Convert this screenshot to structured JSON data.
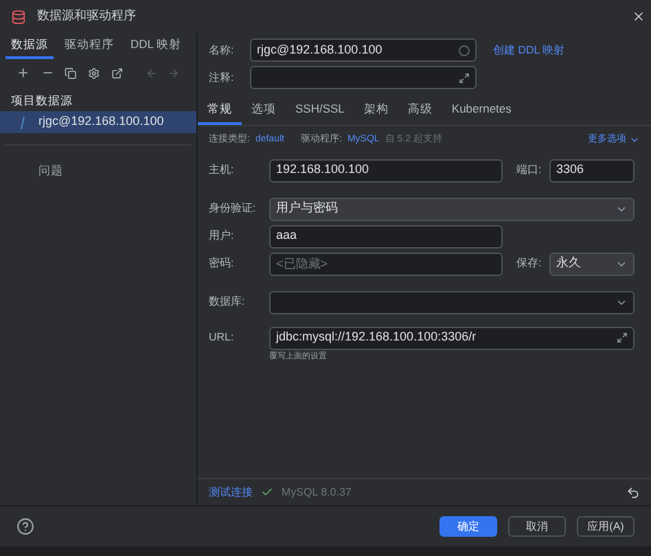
{
  "window": {
    "title": "数据源和驱动程序"
  },
  "left_tabs": [
    {
      "label": "数据源",
      "selected": true
    },
    {
      "label": "驱动程序",
      "selected": false
    },
    {
      "label": "DDL 映射",
      "selected": false
    }
  ],
  "sidebar": {
    "section": "项目数据源",
    "items": [
      {
        "label": "rjgc@192.168.100.100",
        "selected": true
      }
    ],
    "problems": "问题"
  },
  "header": {
    "name_label": "名称:",
    "name_value": "rjgc@192.168.100.100",
    "ddl_link": "创建 DDL 映射",
    "comment_label": "注释:"
  },
  "tabs": [
    {
      "label": "常规",
      "selected": true
    },
    {
      "label": "选项",
      "selected": false
    },
    {
      "label": "SSH/SSL",
      "selected": false
    },
    {
      "label": "架构",
      "selected": false
    },
    {
      "label": "高级",
      "selected": false
    },
    {
      "label": "Kubernetes",
      "selected": false
    }
  ],
  "info": {
    "conn_type_label": "连接类型:",
    "conn_type": "default",
    "driver_label": "驱动程序:",
    "driver": "MySQL",
    "driver_note": "自 5.2 起支持",
    "more": "更多选项"
  },
  "host": {
    "label": "主机:",
    "value": "192.168.100.100",
    "port_label": "端口:",
    "port": "3306"
  },
  "auth": {
    "label": "身份验证:",
    "value": "用户与密码"
  },
  "user": {
    "label": "用户:",
    "value": "aaa"
  },
  "password": {
    "label": "密码:",
    "placeholder": "<已隐藏>",
    "save_label": "保存:",
    "save_value": "永久"
  },
  "database": {
    "label": "数据库:"
  },
  "url": {
    "label": "URL:",
    "value": "jdbc:mysql://192.168.100.100:3306/r",
    "hint": "覆写上面的设置"
  },
  "test": {
    "link": "测试连接",
    "result": "MySQL 8.0.37"
  },
  "buttons": [
    {
      "label": "确定",
      "primary": true
    },
    {
      "label": "取消",
      "primary": false
    },
    {
      "label": "应用(A)",
      "primary": false
    }
  ]
}
